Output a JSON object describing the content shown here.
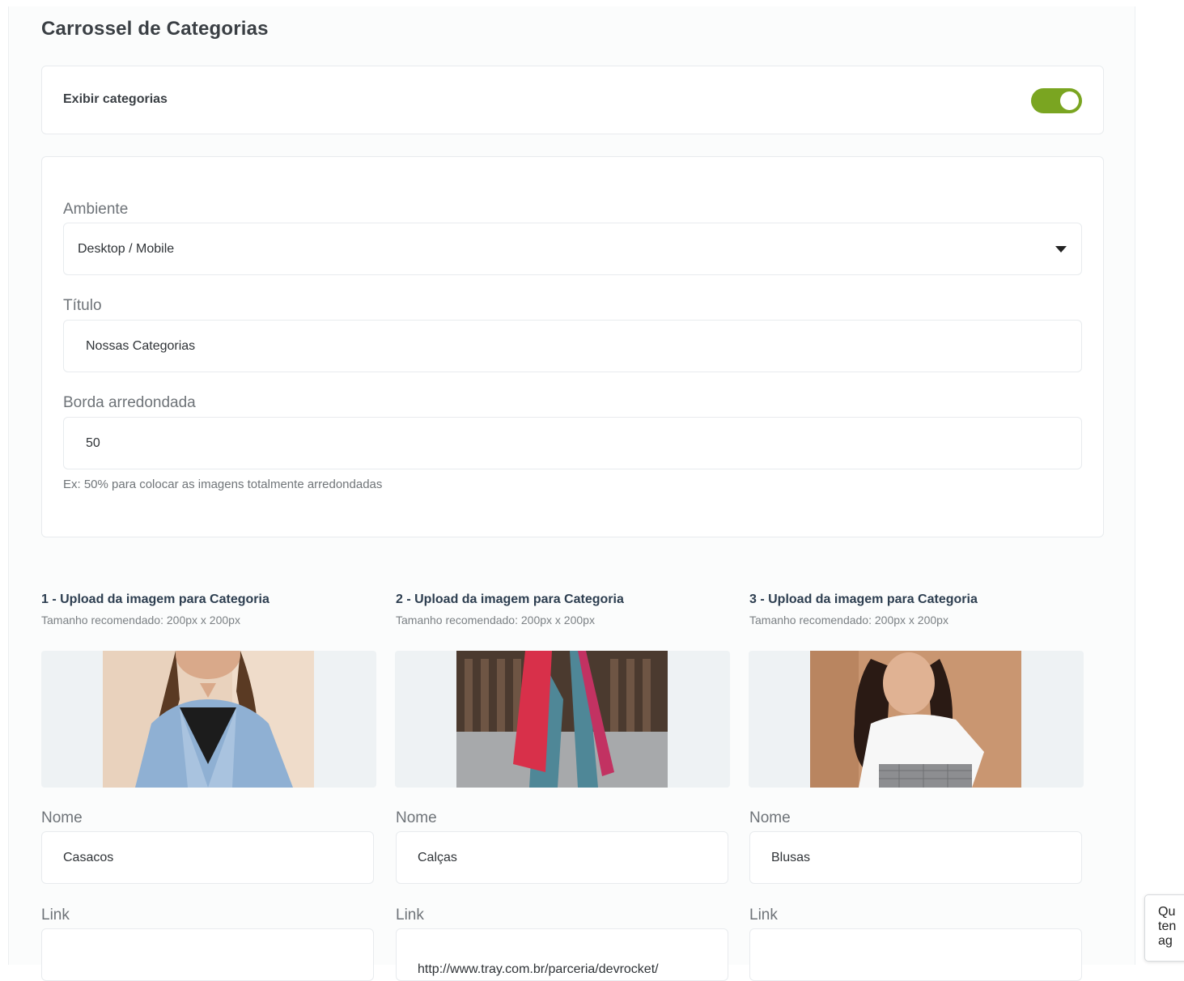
{
  "section": {
    "title": "Carrossel de Categorias"
  },
  "toggle": {
    "label": "Exibir categorias",
    "enabled": true,
    "color": "#7aa521"
  },
  "settings": {
    "ambiente_label": "Ambiente",
    "ambiente_value": "Desktop / Mobile",
    "titulo_label": "Título",
    "titulo_value": "Nossas Categorias",
    "borda_label": "Borda arredondada",
    "borda_value": "50",
    "hint": "Ex: 50% para colocar as imagens totalmente arredondadas"
  },
  "categories": [
    {
      "title": "1 - Upload da imagem para Categoria",
      "size_hint": "Tamanho recomendado: 200px x 200px",
      "name_label": "Nome",
      "name_value": "Casacos",
      "link_label": "Link",
      "link_value": ""
    },
    {
      "title": "2 - Upload da imagem para Categoria",
      "size_hint": "Tamanho recomendado: 200px x 200px",
      "name_label": "Nome",
      "name_value": "Calças",
      "link_label": "Link",
      "link_value": "http://www.tray.com.br/parceria/devrocket/"
    },
    {
      "title": "3 - Upload da imagem para Categoria",
      "size_hint": "Tamanho recomendado: 200px x 200px",
      "name_label": "Nome",
      "name_value": "Blusas",
      "link_label": "Link",
      "link_value": ""
    }
  ],
  "chat": {
    "line1": "Qu",
    "line2": "ten",
    "line3": "ag"
  }
}
